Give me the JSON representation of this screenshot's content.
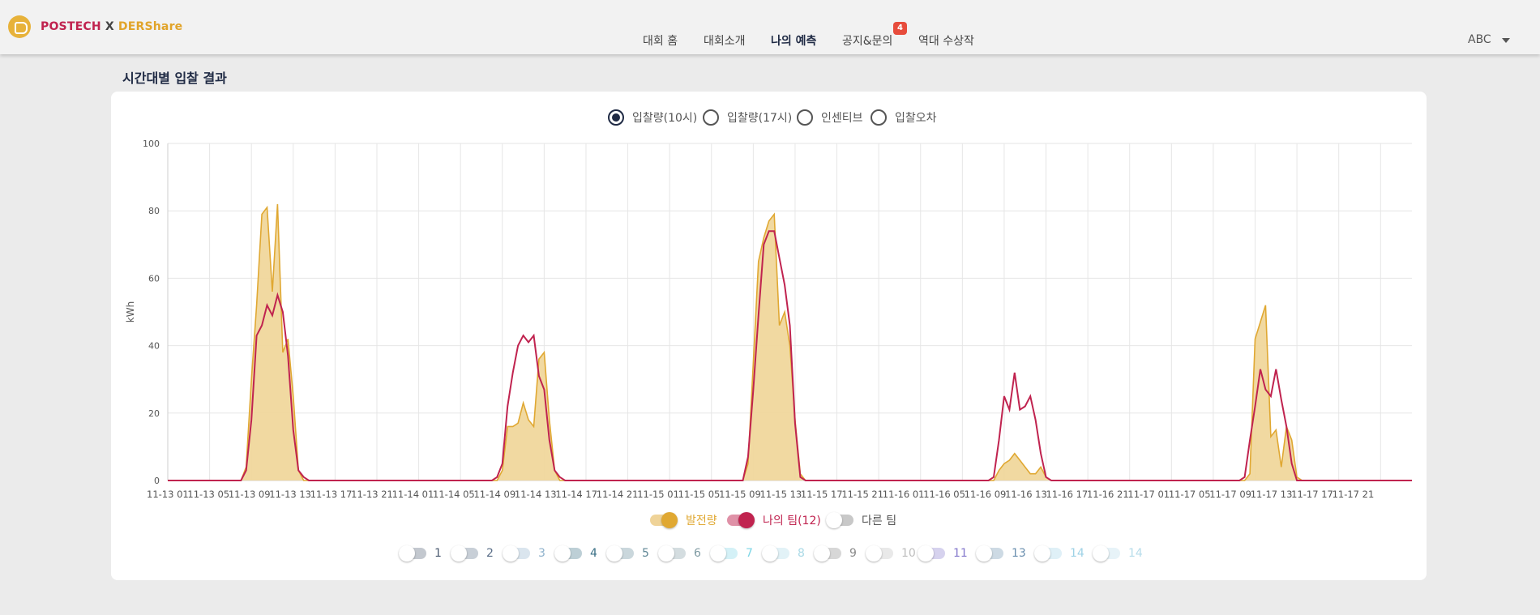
{
  "header": {
    "logo": {
      "part1": "POSTECH",
      "part2": "X",
      "part3": "DERShare"
    },
    "menu": [
      {
        "label": "대회 홈",
        "active": false
      },
      {
        "label": "대회소개",
        "active": false
      },
      {
        "label": "나의 예측",
        "active": true
      },
      {
        "label": "공지&문의",
        "active": false
      },
      {
        "label": "역대 수상작",
        "active": false
      }
    ],
    "notice_badge": "4",
    "user": "ABC"
  },
  "section_title": "시간대별 입찰 결과",
  "radios": [
    {
      "label": "입찰량(10시)",
      "checked": true
    },
    {
      "label": "입찰량(17시)",
      "checked": false
    },
    {
      "label": "인센티브",
      "checked": false
    },
    {
      "label": "입찰오차",
      "checked": false
    }
  ],
  "legend": [
    {
      "label": "발전량",
      "on": true,
      "color": "#e0a832"
    },
    {
      "label": "나의 팀(12)",
      "on": true,
      "color": "#c0234f"
    },
    {
      "label": "다른 팀",
      "on": false,
      "color": "#555555"
    }
  ],
  "team_toggles": [
    {
      "label": "1",
      "color": "#4a5a70"
    },
    {
      "label": "2",
      "color": "#5a6e88"
    },
    {
      "label": "3",
      "color": "#8fb2cc"
    },
    {
      "label": "4",
      "color": "#3a6f85"
    },
    {
      "label": "5",
      "color": "#5f8795"
    },
    {
      "label": "6",
      "color": "#7e9aa2"
    },
    {
      "label": "7",
      "color": "#7dd6e6"
    },
    {
      "label": "8",
      "color": "#a9d9e6"
    },
    {
      "label": "9",
      "color": "#888888"
    },
    {
      "label": "10",
      "color": "#bdbdbd"
    },
    {
      "label": "11",
      "color": "#8478cc"
    },
    {
      "label": "13",
      "color": "#6a8faf"
    },
    {
      "label": "14",
      "color": "#9ed2e6"
    },
    {
      "label": "14",
      "color": "#b6dcea"
    }
  ],
  "chart_data": {
    "type": "area",
    "ylabel": "kWh",
    "ylim": [
      0,
      100
    ],
    "yticks": [
      0,
      20,
      40,
      60,
      80,
      100
    ],
    "grid": true,
    "x_tick_labels": [
      "11-13 01",
      "11-13 05",
      "11-13 09",
      "11-13 13",
      "11-13 17",
      "11-13 21",
      "11-14 01",
      "11-14 05",
      "11-14 09",
      "11-14 13",
      "11-14 17",
      "11-14 21",
      "11-15 01",
      "11-15 05",
      "11-15 09",
      "11-15 13",
      "11-15 17",
      "11-15 21",
      "11-16 01",
      "11-16 05",
      "11-16 09",
      "11-16 13",
      "11-16 17",
      "11-16 21",
      "11-17 01",
      "11-17 05",
      "11-17 09",
      "11-17 13",
      "11-17 17",
      "11-17 21"
    ],
    "series": [
      {
        "name": "발전량",
        "color": "#e0a832",
        "fill": "#f0d79c",
        "points": [
          [
            0,
            0
          ],
          [
            7,
            0
          ],
          [
            7.5,
            4
          ],
          [
            8,
            30
          ],
          [
            8.5,
            52
          ],
          [
            9,
            79
          ],
          [
            9.5,
            81
          ],
          [
            10,
            56
          ],
          [
            10.5,
            82
          ],
          [
            11,
            38
          ],
          [
            11.5,
            42
          ],
          [
            12,
            25
          ],
          [
            12.5,
            3
          ],
          [
            13,
            0
          ],
          [
            31.5,
            0
          ],
          [
            32,
            3
          ],
          [
            32.5,
            16
          ],
          [
            33,
            16
          ],
          [
            33.5,
            17
          ],
          [
            34,
            23
          ],
          [
            34.5,
            18
          ],
          [
            35,
            16
          ],
          [
            35.5,
            36
          ],
          [
            36,
            38
          ],
          [
            36.5,
            18
          ],
          [
            37,
            3
          ],
          [
            37.5,
            0
          ],
          [
            55,
            0
          ],
          [
            55.5,
            5
          ],
          [
            56,
            35
          ],
          [
            56.5,
            65
          ],
          [
            57,
            72
          ],
          [
            57.5,
            77
          ],
          [
            58,
            79
          ],
          [
            58.5,
            46
          ],
          [
            59,
            50
          ],
          [
            59.5,
            40
          ],
          [
            60,
            18
          ],
          [
            60.5,
            2
          ],
          [
            61,
            0
          ],
          [
            79,
            0
          ],
          [
            79.5,
            3
          ],
          [
            80,
            5
          ],
          [
            80.5,
            6
          ],
          [
            81,
            8
          ],
          [
            81.5,
            6
          ],
          [
            82,
            4
          ],
          [
            82.5,
            2
          ],
          [
            83,
            2
          ],
          [
            83.5,
            4
          ],
          [
            84,
            1
          ],
          [
            84.5,
            0
          ],
          [
            103,
            0
          ],
          [
            103.5,
            2
          ],
          [
            104,
            42
          ],
          [
            104.5,
            47
          ],
          [
            105,
            52
          ],
          [
            105.5,
            13
          ],
          [
            106,
            15
          ],
          [
            106.5,
            4
          ],
          [
            107,
            16
          ],
          [
            107.5,
            12
          ],
          [
            108,
            1
          ],
          [
            108.5,
            0
          ],
          [
            119,
            0
          ]
        ]
      },
      {
        "name": "나의 팀(12)",
        "color": "#c0234f",
        "points": [
          [
            0,
            0
          ],
          [
            7,
            0
          ],
          [
            7.5,
            3
          ],
          [
            8,
            18
          ],
          [
            8.5,
            43
          ],
          [
            9,
            46
          ],
          [
            9.5,
            52
          ],
          [
            10,
            49
          ],
          [
            10.5,
            55
          ],
          [
            11,
            50
          ],
          [
            11.5,
            37
          ],
          [
            12,
            15
          ],
          [
            12.5,
            3
          ],
          [
            13,
            1
          ],
          [
            13.5,
            0
          ],
          [
            30.5,
            0
          ],
          [
            31,
            0
          ],
          [
            31.5,
            1
          ],
          [
            32,
            5
          ],
          [
            32.5,
            22
          ],
          [
            33,
            32
          ],
          [
            33.5,
            40
          ],
          [
            34,
            43
          ],
          [
            34.5,
            41
          ],
          [
            35,
            43
          ],
          [
            35.5,
            31
          ],
          [
            36,
            27
          ],
          [
            36.5,
            12
          ],
          [
            37,
            3
          ],
          [
            37.5,
            1
          ],
          [
            38,
            0
          ],
          [
            54.5,
            0
          ],
          [
            55,
            0
          ],
          [
            55.5,
            7
          ],
          [
            56,
            27
          ],
          [
            56.5,
            49
          ],
          [
            57,
            70
          ],
          [
            57.5,
            74
          ],
          [
            58,
            74
          ],
          [
            58.5,
            66
          ],
          [
            59,
            58
          ],
          [
            59.5,
            46
          ],
          [
            60,
            17
          ],
          [
            60.5,
            1
          ],
          [
            61,
            0
          ],
          [
            78.5,
            0
          ],
          [
            79,
            1
          ],
          [
            79.5,
            12
          ],
          [
            80,
            25
          ],
          [
            80.5,
            21
          ],
          [
            81,
            32
          ],
          [
            81.5,
            21
          ],
          [
            82,
            22
          ],
          [
            82.5,
            25
          ],
          [
            83,
            18
          ],
          [
            83.5,
            8
          ],
          [
            84,
            1
          ],
          [
            84.5,
            0
          ],
          [
            102.5,
            0
          ],
          [
            103,
            1
          ],
          [
            103.5,
            12
          ],
          [
            104,
            22
          ],
          [
            104.5,
            33
          ],
          [
            105,
            27
          ],
          [
            105.5,
            25
          ],
          [
            106,
            33
          ],
          [
            106.5,
            24
          ],
          [
            107,
            16
          ],
          [
            107.5,
            5
          ],
          [
            108,
            0
          ],
          [
            119,
            0
          ]
        ]
      }
    ]
  }
}
